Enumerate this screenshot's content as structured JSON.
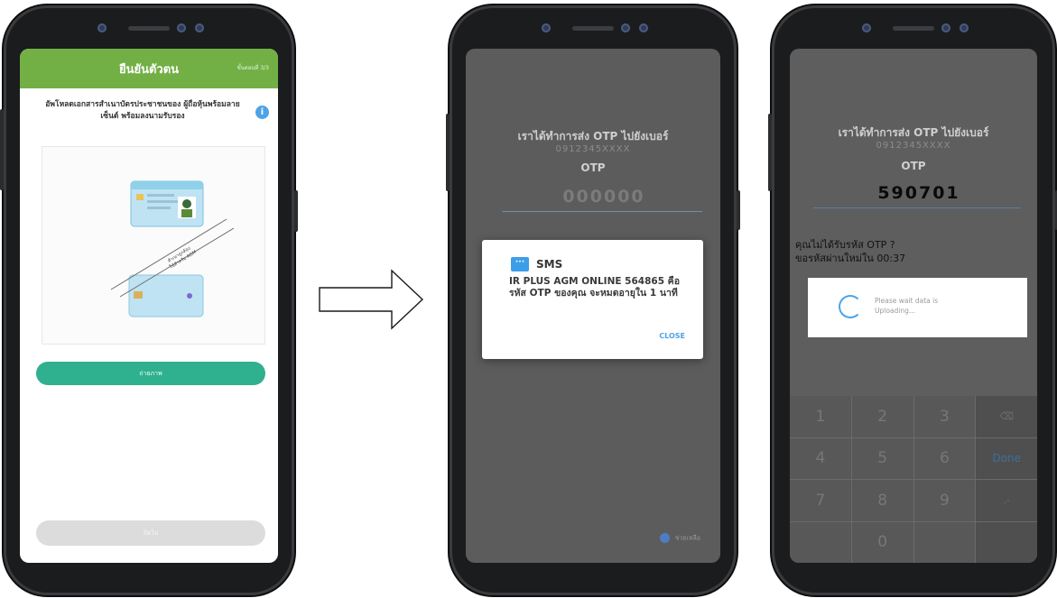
{
  "screen1": {
    "header_title": "ยืนยันตัวตน",
    "header_sub": "ขั้นตอนที่ 3/3",
    "instruction": "อัพโหลดเอกสารสำเนาบัตรประชาชนของ ผู้ถือหุ้นพร้อมลายเซ็นต์ พร้อมลงนามรับรอง",
    "primary_button": "ถ่ายภาพ",
    "back_button": "ถัดไป"
  },
  "screen2": {
    "otp_heading": "เราได้ทำการส่ง OTP ไปยังเบอร์",
    "phone_number": "0912345XXXX",
    "otp_label": "OTP",
    "otp_placeholder": "000000",
    "sms": {
      "app_name": "SMS",
      "message": "IR PLUS AGM ONLINE 564865 คือรหัส OTP ของคุณ จะหมดอายุใน 1 นาที",
      "close_label": "CLOSE"
    },
    "help_label": "ช่วยเหลือ"
  },
  "screen3": {
    "otp_heading": "เราได้ทำการส่ง OTP ไปยังเบอร์",
    "phone_number": "0912345XXXX",
    "otp_label": "OTP",
    "otp_value": "590701",
    "resend_line1": "คุณไม่ได้รับรหัส OTP ?",
    "resend_line2": "ขอรหัสผ่านใหม่ใน  00:37",
    "upload_text_line1": "Please wait data is",
    "upload_text_line2": "Uploading...",
    "keys": [
      "1",
      "2",
      "3",
      "⌫",
      "4",
      "5",
      "6",
      "Done",
      "7",
      "8",
      "9",
      ".-",
      "",
      "0",
      "",
      ""
    ]
  }
}
